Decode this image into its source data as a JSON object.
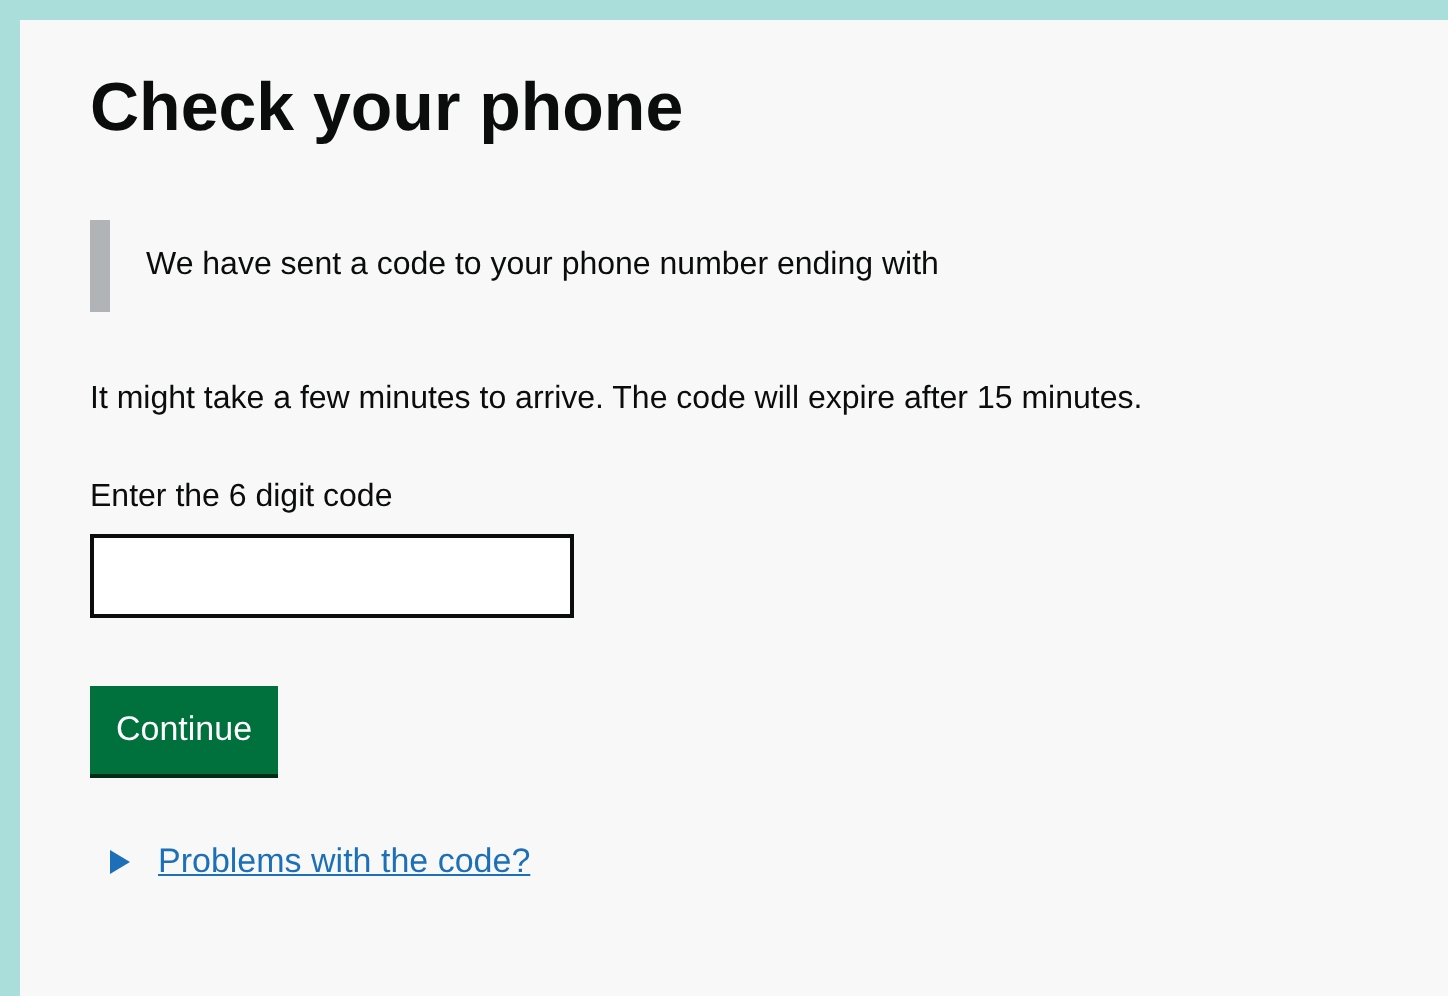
{
  "heading": "Check your phone",
  "inset_text": "We have sent a code to your phone number ending with",
  "body_text": "It might take a few minutes to arrive. The code will expire after 15 minutes.",
  "code_field": {
    "label": "Enter the 6 digit code"
  },
  "continue_button": "Continue",
  "details": {
    "summary": "Problems with the code?",
    "expanded": false
  }
}
